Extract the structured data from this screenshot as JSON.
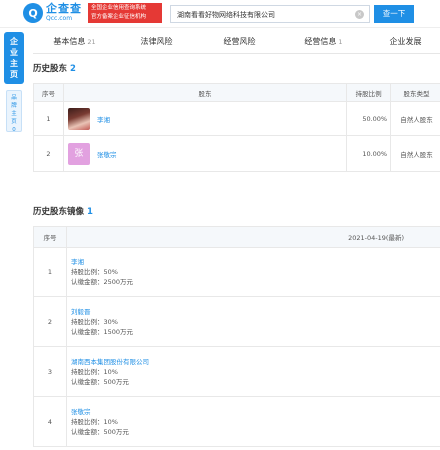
{
  "header": {
    "logo_mark": "Q",
    "logo_title": "企查查",
    "logo_domain": "Qcc.com",
    "slogan_line1": "全国企业信用查询系统",
    "slogan_line2": "官方备案企业征信机构",
    "search_value": "湖南看看好物网络科技有限公司",
    "search_button": "查一下",
    "clear_icon": "×"
  },
  "side": {
    "main_tab": [
      "企",
      "业",
      "主",
      "页"
    ],
    "sub_tab": [
      "品",
      "牌",
      "主",
      "页"
    ],
    "sub_badge": "0"
  },
  "tabs": [
    {
      "label": "基本信息",
      "count": "21"
    },
    {
      "label": "法律风险",
      "count": ""
    },
    {
      "label": "经营风险",
      "count": ""
    },
    {
      "label": "经营信息",
      "count": "1"
    },
    {
      "label": "企业发展",
      "count": ""
    }
  ],
  "shareholders": {
    "title": "历史股东",
    "count": "2",
    "headers": [
      "序号",
      "股东",
      "持股比例",
      "股东类型"
    ],
    "rows": [
      {
        "index": "1",
        "name": "李湘",
        "avatar": "photo",
        "ratio": "50.00%",
        "type": "自然人股东"
      },
      {
        "index": "2",
        "name": "张敬宗",
        "avatar": "张",
        "ratio": "10.00%",
        "type": "自然人股东"
      }
    ]
  },
  "mirror": {
    "title": "历史股东镜像",
    "count": "1",
    "headers": [
      "序号",
      "2021-04-19(最新)"
    ],
    "rows": [
      {
        "index": "1",
        "name": "李湘",
        "ratio_line": "持股比例：50%",
        "amount_line": "认缴金额：2500万元"
      },
      {
        "index": "2",
        "name": "刘毅晋",
        "ratio_line": "持股比例：30%",
        "amount_line": "认缴金额：1500万元"
      },
      {
        "index": "3",
        "name": "湖南西本集团股份有限公司",
        "ratio_line": "持股比例：10%",
        "amount_line": "认缴金额：500万元"
      },
      {
        "index": "4",
        "name": "张敬宗",
        "ratio_line": "持股比例：10%",
        "amount_line": "认缴金额：500万元"
      }
    ]
  },
  "colors": {
    "accent": "#1f8fe5",
    "slogan_bg": "#e53935"
  }
}
